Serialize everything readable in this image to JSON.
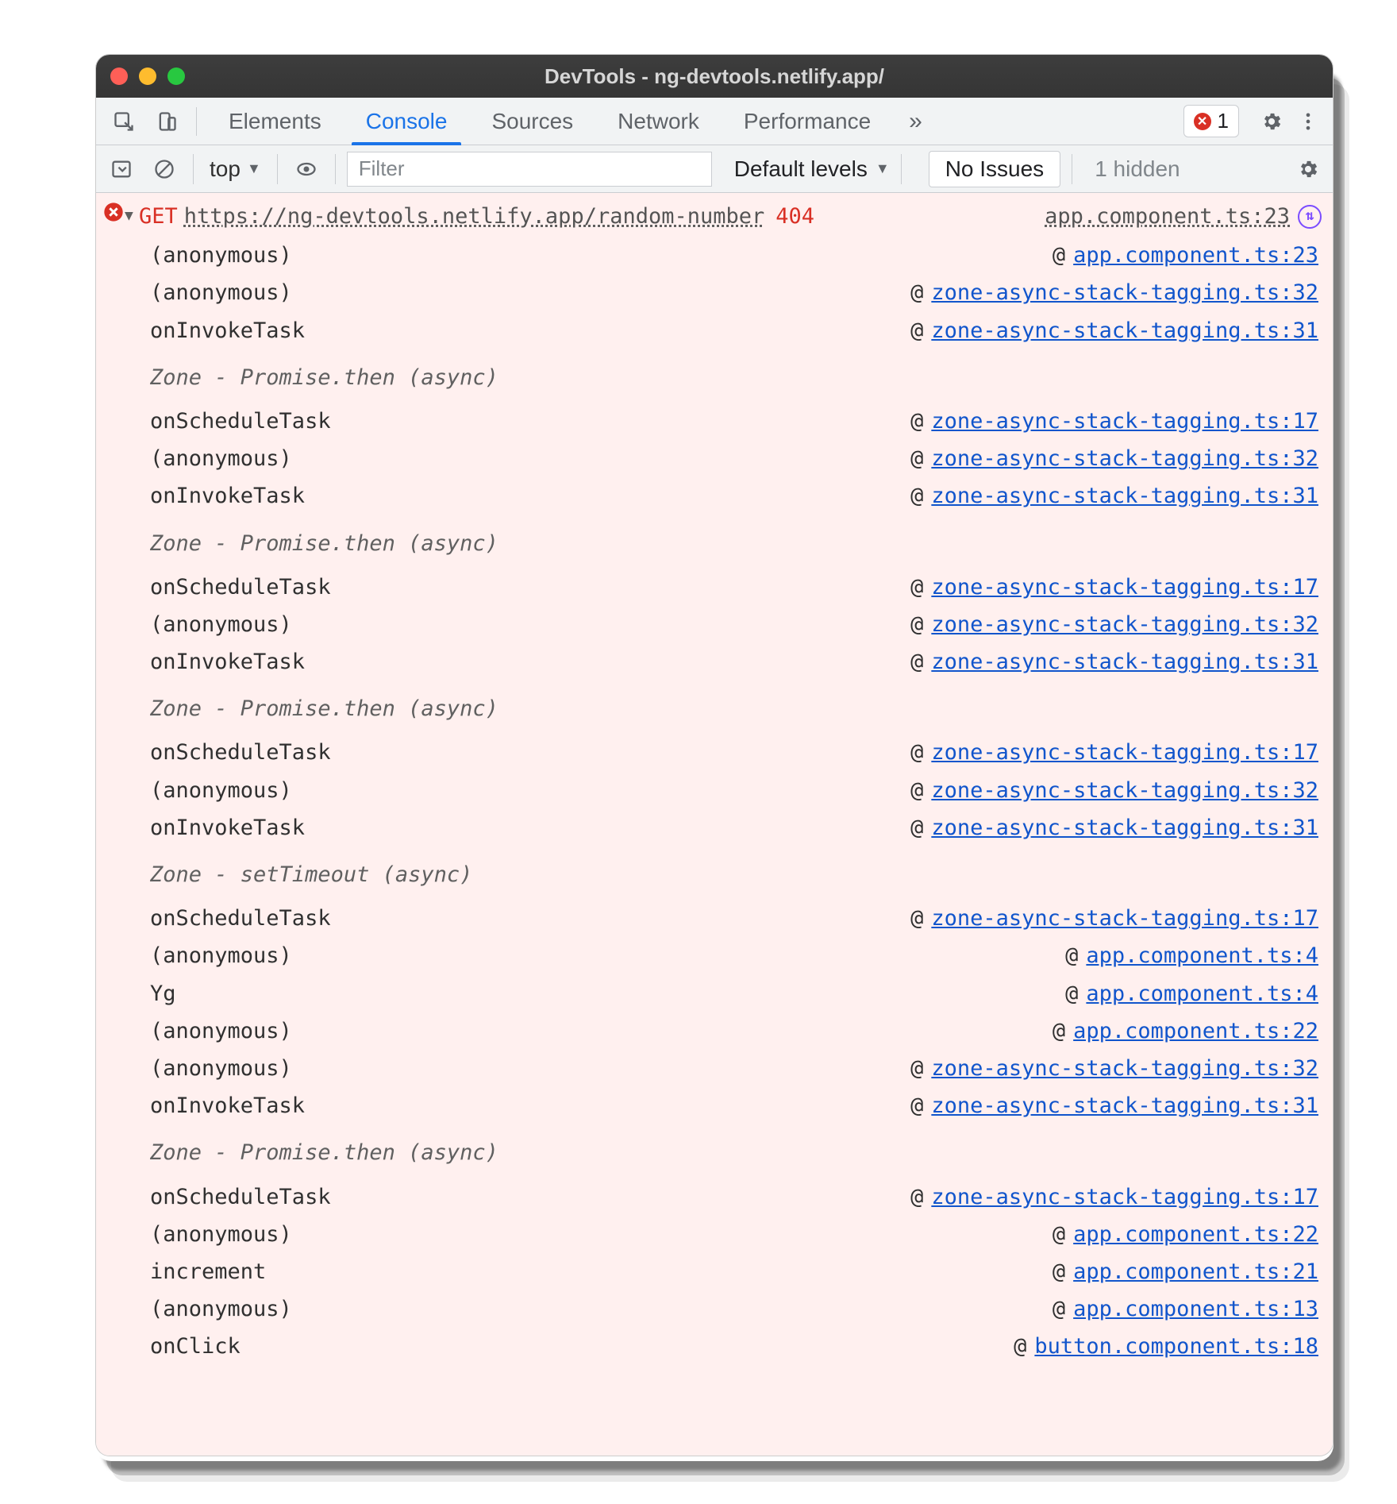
{
  "window_title": "DevTools - ng-devtools.netlify.app/",
  "tabs": {
    "elements": "Elements",
    "console": "Console",
    "sources": "Sources",
    "network": "Network",
    "performance": "Performance"
  },
  "error_chip_count": "1",
  "filterbar": {
    "context": "top",
    "filter_placeholder": "Filter",
    "levels": "Default levels",
    "issues": "No Issues",
    "hidden": "1 hidden"
  },
  "error": {
    "method": "GET",
    "url": "https://ng-devtools.netlify.app/random-number",
    "status": "404",
    "origin": "app.component.ts:23"
  },
  "trace": [
    {
      "type": "frame",
      "fn": "(anonymous)",
      "loc": "app.component.ts:23"
    },
    {
      "type": "frame",
      "fn": "(anonymous)",
      "loc": "zone-async-stack-tagging.ts:32"
    },
    {
      "type": "frame",
      "fn": "onInvokeTask",
      "loc": "zone-async-stack-tagging.ts:31"
    },
    {
      "type": "async",
      "label": "Zone - Promise.then (async)"
    },
    {
      "type": "frame",
      "fn": "onScheduleTask",
      "loc": "zone-async-stack-tagging.ts:17"
    },
    {
      "type": "frame",
      "fn": "(anonymous)",
      "loc": "zone-async-stack-tagging.ts:32"
    },
    {
      "type": "frame",
      "fn": "onInvokeTask",
      "loc": "zone-async-stack-tagging.ts:31"
    },
    {
      "type": "async",
      "label": "Zone - Promise.then (async)"
    },
    {
      "type": "frame",
      "fn": "onScheduleTask",
      "loc": "zone-async-stack-tagging.ts:17"
    },
    {
      "type": "frame",
      "fn": "(anonymous)",
      "loc": "zone-async-stack-tagging.ts:32"
    },
    {
      "type": "frame",
      "fn": "onInvokeTask",
      "loc": "zone-async-stack-tagging.ts:31"
    },
    {
      "type": "async",
      "label": "Zone - Promise.then (async)"
    },
    {
      "type": "frame",
      "fn": "onScheduleTask",
      "loc": "zone-async-stack-tagging.ts:17"
    },
    {
      "type": "frame",
      "fn": "(anonymous)",
      "loc": "zone-async-stack-tagging.ts:32"
    },
    {
      "type": "frame",
      "fn": "onInvokeTask",
      "loc": "zone-async-stack-tagging.ts:31"
    },
    {
      "type": "async",
      "label": "Zone - setTimeout (async)"
    },
    {
      "type": "frame",
      "fn": "onScheduleTask",
      "loc": "zone-async-stack-tagging.ts:17"
    },
    {
      "type": "frame",
      "fn": "(anonymous)",
      "loc": "app.component.ts:4"
    },
    {
      "type": "frame",
      "fn": "Yg",
      "loc": "app.component.ts:4"
    },
    {
      "type": "frame",
      "fn": "(anonymous)",
      "loc": "app.component.ts:22"
    },
    {
      "type": "frame",
      "fn": "(anonymous)",
      "loc": "zone-async-stack-tagging.ts:32"
    },
    {
      "type": "frame",
      "fn": "onInvokeTask",
      "loc": "zone-async-stack-tagging.ts:31"
    },
    {
      "type": "async",
      "label": "Zone - Promise.then (async)"
    },
    {
      "type": "frame",
      "fn": "onScheduleTask",
      "loc": "zone-async-stack-tagging.ts:17"
    },
    {
      "type": "frame",
      "fn": "(anonymous)",
      "loc": "app.component.ts:22"
    },
    {
      "type": "frame",
      "fn": "increment",
      "loc": "app.component.ts:21"
    },
    {
      "type": "frame",
      "fn": "(anonymous)",
      "loc": "app.component.ts:13"
    },
    {
      "type": "frame",
      "fn": "onClick",
      "loc": "button.component.ts:18"
    }
  ]
}
